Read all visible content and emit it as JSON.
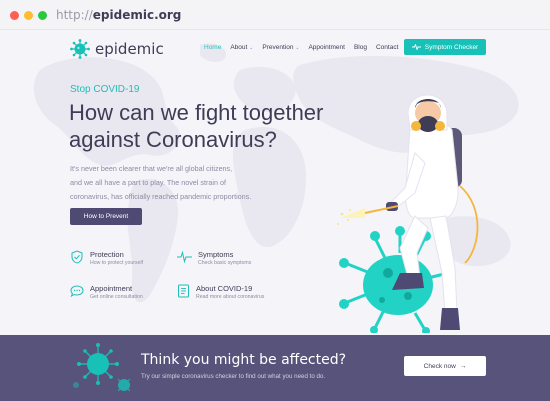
{
  "browser": {
    "url_prefix": "http://",
    "url_domain": "epidemic.org"
  },
  "nav": {
    "logo": "epidemic",
    "items": [
      {
        "label": "Home",
        "active": true,
        "dropdown": false
      },
      {
        "label": "About",
        "active": false,
        "dropdown": true
      },
      {
        "label": "Prevention",
        "active": false,
        "dropdown": true
      },
      {
        "label": "Appointment",
        "active": false,
        "dropdown": false
      },
      {
        "label": "Blog",
        "active": false,
        "dropdown": false
      },
      {
        "label": "Contact",
        "active": false,
        "dropdown": false
      }
    ],
    "cta": {
      "label": "Symptom Checker",
      "icon": "pulse-icon"
    }
  },
  "hero": {
    "eyebrow": "Stop COVID-19",
    "headline_line1": "How can we fight together",
    "headline_line2": "against Coronavirus?",
    "lead_line1": "It's never been clearer that we're all global citizens,",
    "lead_line2": "and we all have a part to play. The novel strain of",
    "lead_line3": "coronavirus, has officially reached pandemic proportions.",
    "cta": "How to Prevent"
  },
  "features": [
    {
      "title": "Protection",
      "subtitle": "How to protect yourself",
      "icon": "shield-check-icon"
    },
    {
      "title": "Symptoms",
      "subtitle": "Check basic symptoms",
      "icon": "pulse-icon"
    },
    {
      "title": "Appointment",
      "subtitle": "Get online consultation",
      "icon": "chat-icon"
    },
    {
      "title": "About COVID-19",
      "subtitle": "Read more about coronavirus",
      "icon": "document-icon"
    }
  ],
  "banner": {
    "title": "Think you might be affected?",
    "subtitle": "Try our simple coronavirus checker to find out what you need to do.",
    "button": "Check now",
    "button_icon": "arrow-right-icon"
  },
  "colors": {
    "accent": "#1dc7c0",
    "dark": "#3f3d56",
    "banner": "#58537a",
    "button_dark": "#4f4a74",
    "virus": "#22d3c5"
  }
}
